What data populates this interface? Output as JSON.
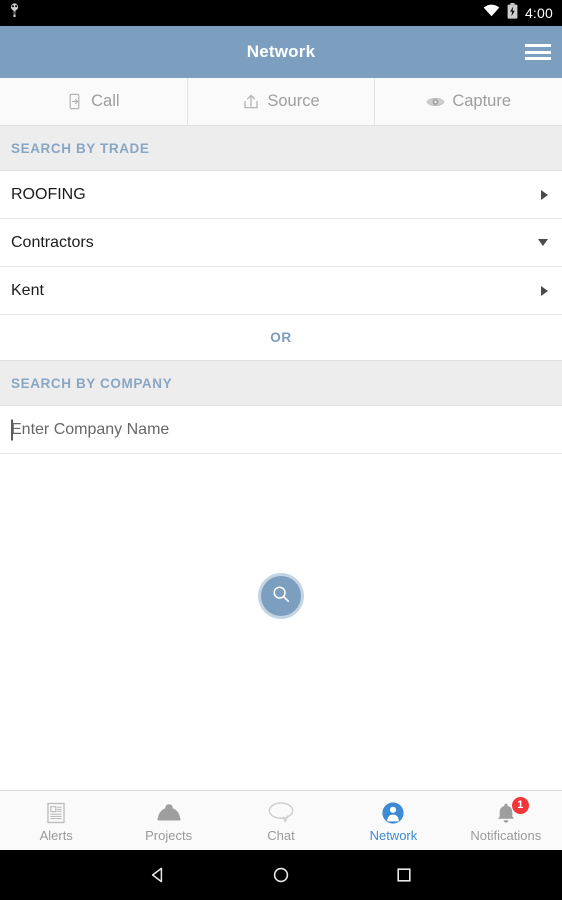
{
  "statusbar": {
    "time": "4:00",
    "icons": [
      "usb-debug-icon",
      "wifi-icon",
      "battery-charging-icon"
    ]
  },
  "appbar": {
    "title": "Network",
    "menu_icon": "hamburger-menu-icon"
  },
  "tabs": [
    {
      "label": "Call",
      "icon": "phone-forward-icon",
      "active": false
    },
    {
      "label": "Source",
      "icon": "share-export-icon",
      "active": false
    },
    {
      "label": "Capture",
      "icon": "eye-icon",
      "active": false
    }
  ],
  "search_by_trade": {
    "header": "SEARCH BY TRADE",
    "rows": [
      {
        "label": "ROOFING",
        "caret": "caret-right-icon"
      },
      {
        "label": "Contractors",
        "caret": "caret-down-icon"
      },
      {
        "label": "Kent",
        "caret": "caret-right-icon"
      }
    ]
  },
  "divider": {
    "label": "OR"
  },
  "search_by_company": {
    "header": "SEARCH BY COMPANY",
    "input_placeholder": "Enter Company Name",
    "input_value": ""
  },
  "search_button": {
    "icon": "search-icon"
  },
  "bottom_nav": [
    {
      "label": "Alerts",
      "icon": "news-article-icon",
      "active": false,
      "badge": ""
    },
    {
      "label": "Projects",
      "icon": "hard-hat-icon",
      "active": false,
      "badge": ""
    },
    {
      "label": "Chat",
      "icon": "speech-bubble-icon",
      "active": false,
      "badge": ""
    },
    {
      "label": "Network",
      "icon": "person-icon",
      "active": true,
      "badge": ""
    },
    {
      "label": "Notifications",
      "icon": "bell-icon",
      "active": false,
      "badge": "1"
    }
  ],
  "system_nav": [
    {
      "name": "back-button",
      "icon": "triangle-back-icon"
    },
    {
      "name": "home-button",
      "icon": "circle-home-icon"
    },
    {
      "name": "recents-button",
      "icon": "square-recents-icon"
    }
  ],
  "colors": {
    "appbar": "#7d9fbf",
    "accent_label": "#89a6c4",
    "active_nav": "#3d8bd4",
    "badge": "#f4353a",
    "section_bg": "#ededed"
  }
}
